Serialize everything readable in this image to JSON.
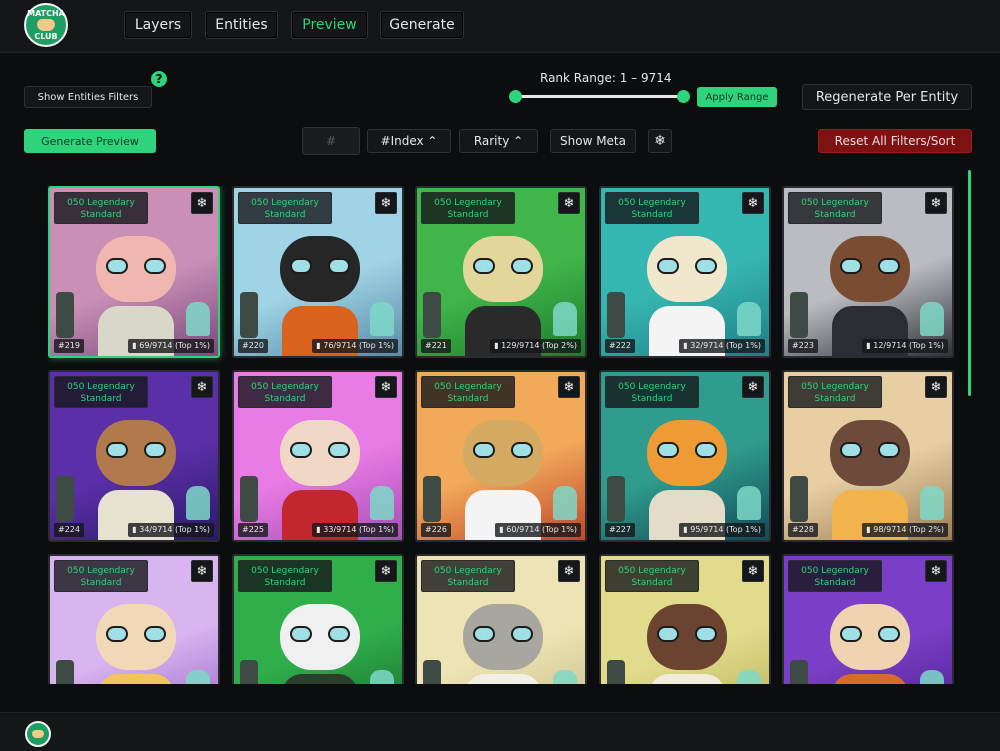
{
  "logo": {
    "line1": "MATCHA",
    "line2": "CLUB"
  },
  "nav": [
    {
      "label": "Layers",
      "active": false
    },
    {
      "label": "Entities",
      "active": false
    },
    {
      "label": "Preview",
      "active": true
    },
    {
      "label": "Generate",
      "active": false
    }
  ],
  "controls": {
    "show_filters": "Show Entities Filters",
    "help": "?",
    "rank_range": "Rank Range: 1 – 9714",
    "apply_range": "Apply Range",
    "regenerate": "Regenerate Per Entity",
    "generate_preview": "Generate Preview",
    "hash_placeholder": "#",
    "sort_index": "#Index ⌃",
    "sort_rarity": "Rarity ⌃",
    "show_meta": "Show Meta",
    "snowflake": "❄",
    "reset": "Reset All Filters/Sort"
  },
  "colors": {
    "accent": "#2fd37c",
    "danger": "#7d1212",
    "background": "#0c0d0f"
  },
  "cards": [
    {
      "tag1": "050 Legendary",
      "tag2": "Standard",
      "id": "#219",
      "rank": "▮ 69/9714 (Top 1%)",
      "bg": "#c98fb7",
      "bg2": "#7a4a7b",
      "head": "#f0b7b1",
      "body": "#d9d7c9"
    },
    {
      "tag1": "050 Legendary",
      "tag2": "Standard",
      "id": "#220",
      "rank": "▮ 76/9714 (Top 1%)",
      "bg": "#9fd4e6",
      "bg2": "#5a8aa6",
      "head": "#262626",
      "body": "#d8621e"
    },
    {
      "tag1": "050 Legendary",
      "tag2": "Standard",
      "id": "#221",
      "rank": "▮ 129/9714 (Top 2%)",
      "bg": "#3fb54a",
      "bg2": "#1f7b2c",
      "head": "#e3d69a",
      "body": "#2a2a2a"
    },
    {
      "tag1": "050 Legendary",
      "tag2": "Standard",
      "id": "#222",
      "rank": "▮ 32/9714 (Top 1%)",
      "bg": "#36b6b0",
      "bg2": "#1f7e86",
      "head": "#f1e7cd",
      "body": "#f4f4f4"
    },
    {
      "tag1": "050 Legendary",
      "tag2": "Standard",
      "id": "#223",
      "rank": "▮ 12/9714 (Top 1%)",
      "bg": "#b9bdc2",
      "bg2": "#2f3236",
      "head": "#7a4d33",
      "body": "#2b2d33"
    },
    {
      "tag1": "050 Legendary",
      "tag2": "Standard",
      "id": "#224",
      "rank": "▮ 34/9714 (Top 1%)",
      "bg": "#5b2fa8",
      "bg2": "#2a1a66",
      "head": "#b07a4d",
      "body": "#e7e2cf"
    },
    {
      "tag1": "050 Legendary",
      "tag2": "Standard",
      "id": "#225",
      "rank": "▮ 33/9714 (Top 1%)",
      "bg": "#e97be6",
      "bg2": "#a44fb5",
      "head": "#f1d7c6",
      "body": "#c1272d"
    },
    {
      "tag1": "050 Legendary",
      "tag2": "Standard",
      "id": "#226",
      "rank": "▮ 60/9714 (Top 1%)",
      "bg": "#f1a95a",
      "bg2": "#c0462a",
      "head": "#d4aa62",
      "body": "#f4f4f4"
    },
    {
      "tag1": "050 Legendary",
      "tag2": "Standard",
      "id": "#227",
      "rank": "▮ 95/9714 (Top 1%)",
      "bg": "#2f9c8d",
      "bg2": "#124a5a",
      "head": "#ee9a35",
      "body": "#e2dcc8"
    },
    {
      "tag1": "050 Legendary",
      "tag2": "Standard",
      "id": "#228",
      "rank": "▮ 98/9714 (Top 2%)",
      "bg": "#e7cfa3",
      "bg2": "#9c7d52",
      "head": "#6d4a3a",
      "body": "#f2b24c"
    },
    {
      "tag1": "050 Legendary",
      "tag2": "Standard",
      "id": "",
      "rank": "",
      "bg": "#d8b4f0",
      "bg2": "#9a6bc8",
      "head": "#f1d9b7",
      "body": "#f0c55c"
    },
    {
      "tag1": "050 Legendary",
      "tag2": "Standard",
      "id": "",
      "rank": "",
      "bg": "#2fae4a",
      "bg2": "#1b6d2e",
      "head": "#f0f0f0",
      "body": "#2f3e2c"
    },
    {
      "tag1": "050 Legendary",
      "tag2": "Standard",
      "id": "",
      "rank": "",
      "bg": "#ece4b4",
      "bg2": "#c9bd8a",
      "head": "#a9a6a0",
      "body": "#f1efe6"
    },
    {
      "tag1": "050 Legendary",
      "tag2": "Standard",
      "id": "",
      "rank": "",
      "bg": "#e1dc8b",
      "bg2": "#b9b35e",
      "head": "#6a4431",
      "body": "#f1ecd9"
    },
    {
      "tag1": "050 Legendary",
      "tag2": "Standard",
      "id": "",
      "rank": "",
      "bg": "#7a3fc6",
      "bg2": "#4c1f8e",
      "head": "#f0d3b0",
      "body": "#d86a2a"
    }
  ]
}
